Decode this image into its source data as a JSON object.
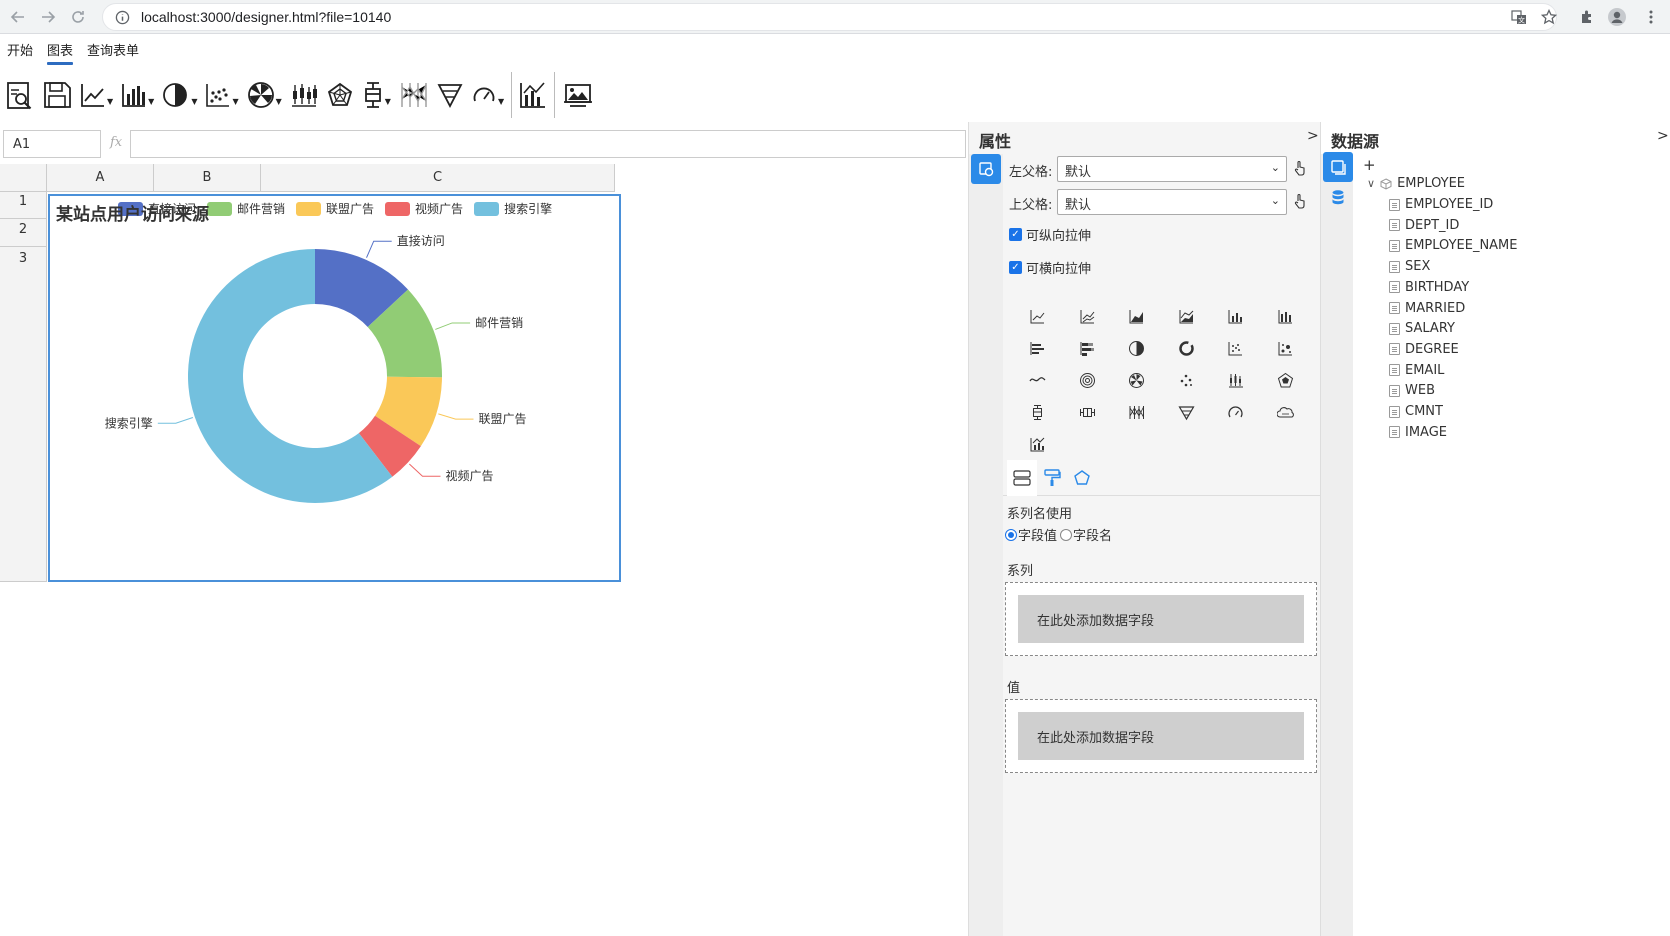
{
  "browser": {
    "url": "localhost:3000/designer.html?file=10140"
  },
  "menu": {
    "tabs": [
      {
        "label": "开始",
        "active": false
      },
      {
        "label": "图表",
        "active": true
      },
      {
        "label": "查询表单",
        "active": false
      }
    ]
  },
  "formula": {
    "cell_ref": "A1",
    "fx": "fx",
    "value": ""
  },
  "sheet": {
    "columns": [
      "A",
      "B",
      "C"
    ],
    "rows": [
      "1",
      "2",
      "3"
    ]
  },
  "chart_data": {
    "type": "pie",
    "title": "某站点用户访问来源",
    "donut": true,
    "legend_position": "top",
    "categories": [
      "直接访问",
      "邮件营销",
      "联盟广告",
      "视频广告",
      "搜索引擎"
    ],
    "values": [
      335,
      310,
      234,
      135,
      1548
    ],
    "colors": [
      "#5470c6",
      "#91cc75",
      "#fac858",
      "#ee6666",
      "#73c0de"
    ]
  },
  "properties": {
    "title": "属性",
    "collapse": ">",
    "left_parent_label": "左父格:",
    "left_parent_value": "默认",
    "top_parent_label": "上父格:",
    "top_parent_value": "默认",
    "vertical_stretch_label": "可纵向拉伸",
    "vertical_stretch_checked": true,
    "horizontal_stretch_label": "可横向拉伸",
    "horizontal_stretch_checked": true,
    "chart_types": [
      "line-chart",
      "stacked-line-chart",
      "area-chart",
      "stacked-area-chart",
      "bar-chart",
      "stacked-bar-chart",
      "horizontal-bar-chart",
      "stacked-horizontal-bar-chart",
      "pie-chart",
      "donut-chart",
      "scatter-chart",
      "bubble-chart",
      "smooth-line-chart",
      "rose-chart",
      "radar-pie-chart",
      "dot-chart",
      "candlestick-chart",
      "radar-chart",
      "boxplot-chart",
      "horizontal-boxplot-chart",
      "parallel-chart",
      "funnel-chart",
      "gauge-chart",
      "wordcloud-chart",
      "combo-chart"
    ],
    "series_name_label": "系列名使用",
    "radio_field_value": "字段值",
    "radio_field_name": "字段名",
    "series_label": "系列",
    "series_drop": "在此处添加数据字段",
    "value_label": "值",
    "value_drop": "在此处添加数据字段"
  },
  "datasource": {
    "title": "数据源",
    "collapse": ">",
    "add": "+",
    "table": "EMPLOYEE",
    "fields": [
      "EMPLOYEE_ID",
      "DEPT_ID",
      "EMPLOYEE_NAME",
      "SEX",
      "BIRTHDAY",
      "MARRIED",
      "SALARY",
      "DEGREE",
      "EMAIL",
      "WEB",
      "CMNT",
      "IMAGE"
    ]
  }
}
